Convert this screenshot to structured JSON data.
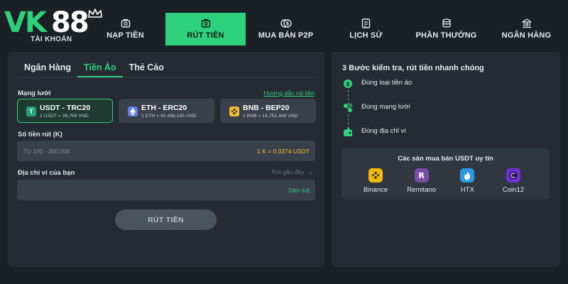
{
  "brand": {
    "logo_text_green": "VK",
    "logo_text_white": "88",
    "logo_behind_text": "TÀI KHOẢN"
  },
  "nav": {
    "items": [
      {
        "label": "NẠP TIỀN",
        "icon": "deposit-icon",
        "active": false
      },
      {
        "label": "RÚT TIỀN",
        "icon": "withdraw-icon",
        "active": true
      },
      {
        "label": "MUA BÁN P2P",
        "icon": "p2p-coin-icon",
        "active": false
      },
      {
        "label": "LỊCH SỬ",
        "icon": "history-document-icon",
        "active": false
      },
      {
        "label": "PHẦN THƯỞNG",
        "icon": "reward-coins-icon",
        "active": false
      },
      {
        "label": "NGÂN HÀNG",
        "icon": "bank-icon",
        "active": false
      }
    ]
  },
  "withdraw": {
    "tabs": [
      {
        "label": "Ngân Hàng",
        "active": false
      },
      {
        "label": "Tiền Ảo",
        "active": true
      },
      {
        "label": "Thẻ Cào",
        "active": false
      }
    ],
    "network_label": "Mạng lưới",
    "guide_link": "Hướng dẫn rút tiền",
    "coins": [
      {
        "name": "USDT - TRC20",
        "rate": "1 USDT = 26,759 VND",
        "icon": "tether-icon",
        "color": "#26a17b",
        "active": true
      },
      {
        "name": "ETH - ERC20",
        "rate": "1 ETH = 42,448,195 VND",
        "icon": "ethereum-icon",
        "color": "#627eea",
        "active": false
      },
      {
        "name": "BNB - BEP20",
        "rate": "1 BNB = 14,752,488 VND",
        "icon": "bnb-icon",
        "color": "#f3ba2f",
        "active": false
      }
    ],
    "amount_label": "Số tiền rút (K)",
    "amount_placeholder": "Từ 100 - 300,000",
    "amount_rate": "1 K = 0.0374 USDT",
    "wallet_label": "Địa chỉ ví của bạn",
    "recent_label": "Rút gần đây",
    "paste_label": "Dán mã",
    "submit_label": "RÚT TIỀN"
  },
  "guide": {
    "title": "3 Bước kiểm tra, rút tiền nhanh chóng",
    "steps": [
      {
        "text": "Đúng loại tiền ảo",
        "icon": "coin-check-icon"
      },
      {
        "text": "Đúng mạng lưới",
        "icon": "network-icon"
      },
      {
        "text": "Đúng địa chỉ ví",
        "icon": "wallet-icon"
      }
    ],
    "exchanges_title": "Các sàn mua bán USDT uy tín",
    "exchanges": [
      {
        "name": "Binance",
        "icon": "binance-icon",
        "color": "#f0b90b"
      },
      {
        "name": "Remitano",
        "icon": "remitano-icon",
        "color": "#7b4ba6"
      },
      {
        "name": "HTX",
        "icon": "htx-icon",
        "color": "#2b9ae0"
      },
      {
        "name": "Coin12",
        "icon": "coin12-icon",
        "color": "#6d2fd6"
      }
    ]
  },
  "colors": {
    "accent": "#2fd27c",
    "background": "#1b1f26",
    "panel": "#262b33",
    "rate_yellow": "#f2c12e"
  }
}
